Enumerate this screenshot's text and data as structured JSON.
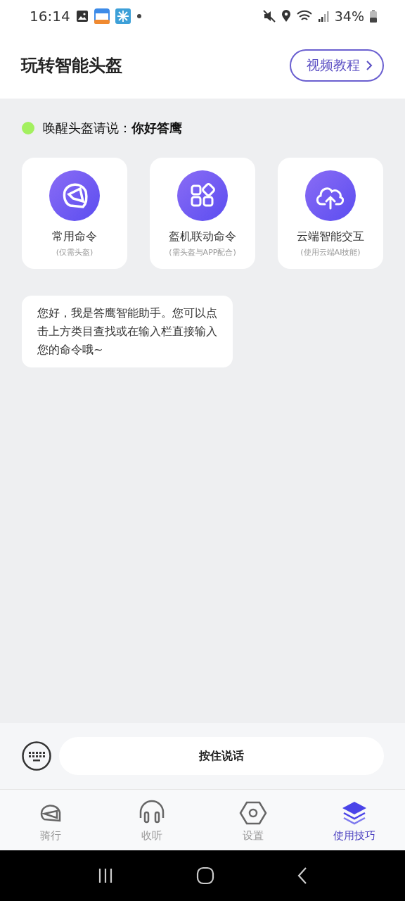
{
  "status_bar": {
    "time": "16:14",
    "battery": "34%"
  },
  "header": {
    "title": "玩转智能头盔",
    "tutorial_button": "视频教程"
  },
  "wake_hint": {
    "text": "唤醒头盔请说：**你好答鹰**",
    "color": "#a3f05f"
  },
  "command_cards": [
    {
      "kind": "helmet",
      "title": "常用命令",
      "subtitle": "(仅需头盔)"
    },
    {
      "kind": "apps",
      "title": "盔机联动命令",
      "subtitle": "(需头盔与APP配合)"
    },
    {
      "kind": "cloud",
      "title": "云端智能交互",
      "subtitle": "(使用云端AI技能)"
    }
  ],
  "assistant_message": "您好，我是答鹰智能助手。您可以点击上方类目查找或在输入栏直接输入您的命令哦~",
  "input_bar": {
    "hold_to_talk": "按住说话"
  },
  "tabs": [
    {
      "kind": "helmet",
      "label": "骑行",
      "selected": false
    },
    {
      "kind": "headphones",
      "label": "收听",
      "selected": false
    },
    {
      "kind": "settings",
      "label": "设置",
      "selected": false
    },
    {
      "kind": "layers",
      "label": "使用技巧",
      "selected": true
    }
  ]
}
